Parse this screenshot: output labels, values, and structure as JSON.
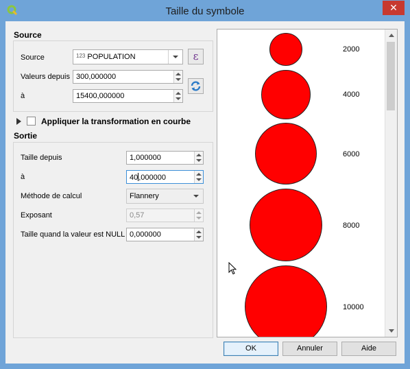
{
  "window": {
    "title": "Taille du symbole",
    "close_glyph": "✕"
  },
  "source": {
    "heading": "Source",
    "source_label": "Source",
    "source_type": "123",
    "source_value": "POPULATION",
    "from_label": "Valeurs depuis",
    "from_value": "300,000000",
    "to_label": "à",
    "to_value": "15400,000000",
    "expression_glyph": "ε"
  },
  "curve": {
    "label": "Appliquer la transformation en courbe"
  },
  "output": {
    "heading": "Sortie",
    "size_from_label": "Taille depuis",
    "size_from_value": "1,000000",
    "size_to_label": "à",
    "size_to_before_caret": "40",
    "size_to_after_caret": ",000000",
    "method_label": "Méthode de calcul",
    "method_value": "Flannery",
    "exponent_label": "Exposant",
    "exponent_value": "0,57",
    "null_label": "Taille quand la valeur est NULL",
    "null_value": "0,000000"
  },
  "preview": {
    "legend": [
      {
        "label": "2000"
      },
      {
        "label": "4000"
      },
      {
        "label": "6000"
      },
      {
        "label": "8000"
      },
      {
        "label": "10000"
      }
    ],
    "symbol_color": "#ff0000"
  },
  "buttons": {
    "ok": "OK",
    "cancel": "Annuler",
    "help": "Aide"
  }
}
